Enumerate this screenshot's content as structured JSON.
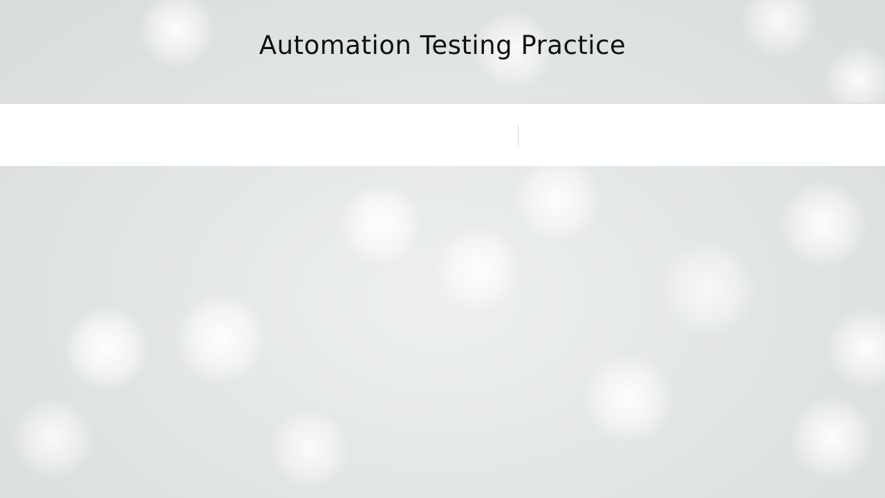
{
  "header": {
    "site_title": "Automation Testing Practice"
  },
  "theme": {
    "title_color": "#111111",
    "nav_background": "#ffffff",
    "page_background": "#e6e8e9"
  }
}
